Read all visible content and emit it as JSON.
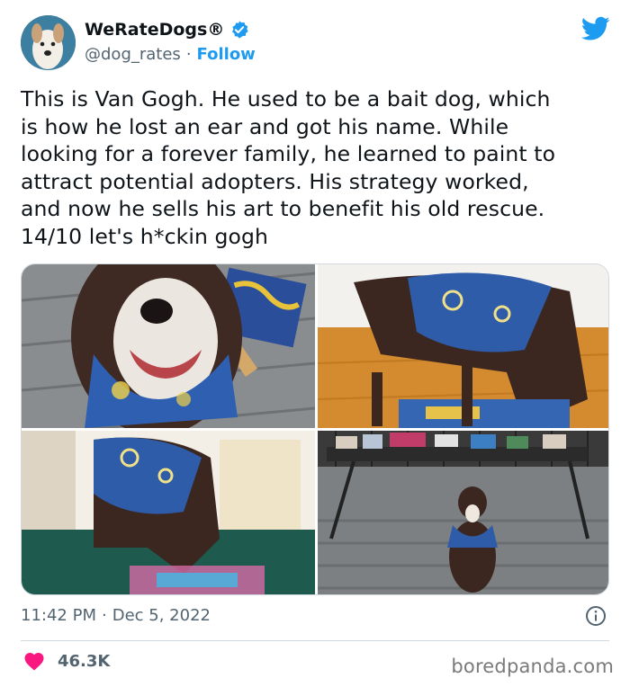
{
  "author": {
    "display_name": "WeRateDogs",
    "registered_mark": "®",
    "handle": "@dog_rates",
    "separator": "·",
    "follow_label": "Follow"
  },
  "tweet": {
    "lines": [
      "This is Van Gogh. He used to be a bait dog, which",
      "is how he lost an ear and got his name. While",
      "looking for a forever family, he learned to paint to",
      "attract potential adopters. His strategy worked,",
      "and now he sells his art to benefit his old rescue.",
      "14/10 let's h*ckin gogh"
    ]
  },
  "meta": {
    "time": "11:42 PM",
    "separator": "·",
    "date": "Dec 5, 2022"
  },
  "engagement": {
    "likes": "46.3K"
  },
  "watermark": "boredpanda.com",
  "colors": {
    "accent": "#1d9bf0",
    "heart": "#f91880",
    "text": "#0f1419",
    "muted": "#536471"
  },
  "icons": [
    "verified-badge-icon",
    "twitter-bird-icon",
    "info-icon",
    "heart-icon"
  ]
}
